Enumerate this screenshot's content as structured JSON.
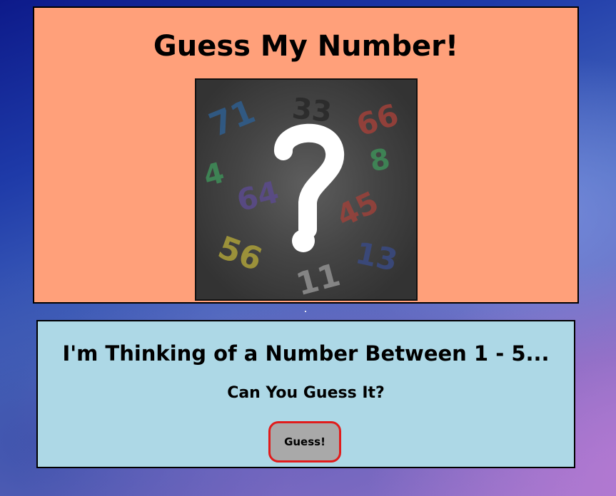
{
  "header": {
    "title": "Guess My Number!"
  },
  "hero": {
    "icon": "question-mark-icon",
    "numbers": [
      {
        "text": "71",
        "color": "#2f5e8e"
      },
      {
        "text": "33",
        "color": "#2a2a2a"
      },
      {
        "text": "66",
        "color": "#a0413a"
      },
      {
        "text": "4",
        "color": "#3e8e58"
      },
      {
        "text": "8",
        "color": "#3e8e58"
      },
      {
        "text": "64",
        "color": "#5a4a8c"
      },
      {
        "text": "45",
        "color": "#a0413a"
      },
      {
        "text": "56",
        "color": "#a59a3a"
      },
      {
        "text": "13",
        "color": "#3a4a82"
      },
      {
        "text": "11",
        "color": "#8c8c8c"
      }
    ]
  },
  "prompt": {
    "heading": "I'm Thinking of a Number Between 1 - 5...",
    "subheading": "Can You Guess It?",
    "button_label": "Guess!"
  },
  "colors": {
    "top_panel": "#ffa07a",
    "bottom_panel": "#add8e6",
    "button_fill": "#a9a9a9",
    "button_border": "#e11b1b"
  }
}
